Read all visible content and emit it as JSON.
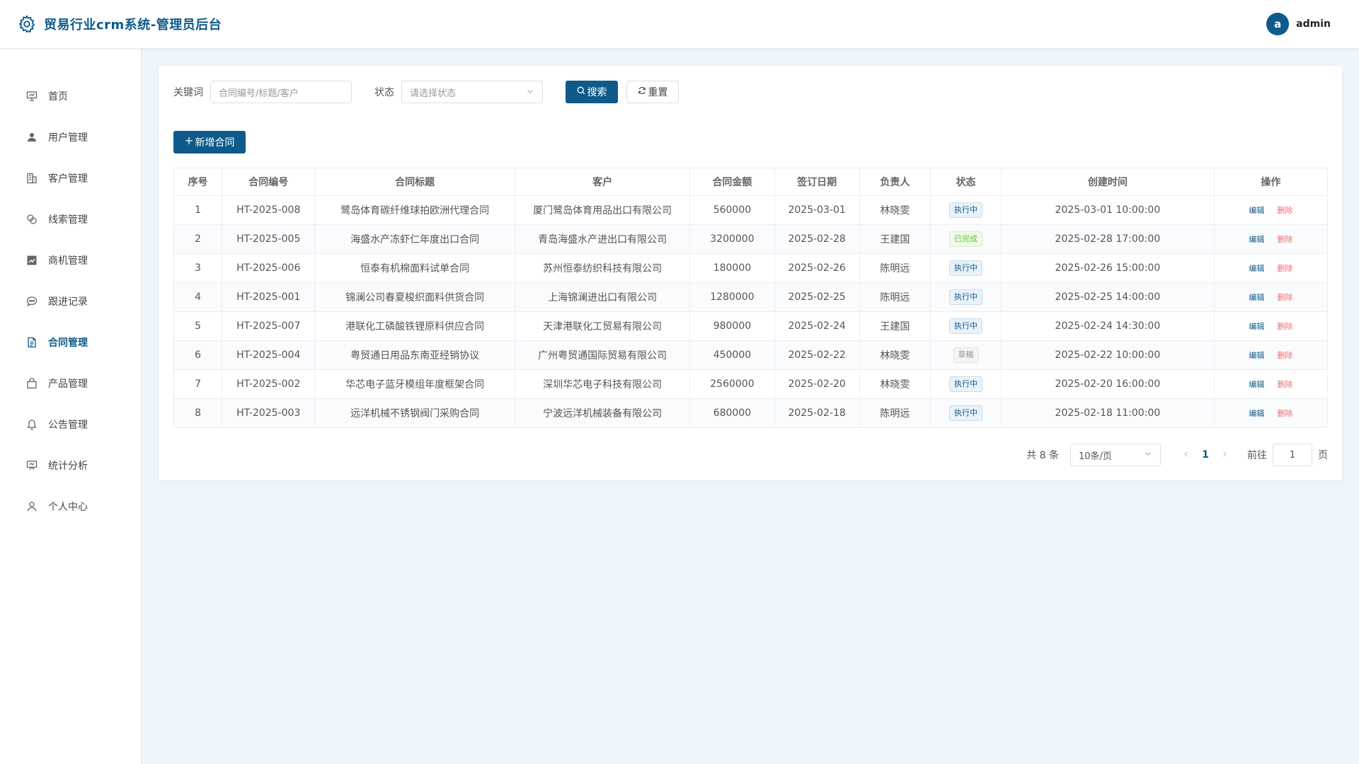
{
  "header": {
    "title": "贸易行业crm系统-管理员后台",
    "avatar_letter": "a",
    "username": "admin"
  },
  "sidebar": {
    "items": [
      {
        "label": "首页",
        "icon": "presentation-icon"
      },
      {
        "label": "用户管理",
        "icon": "user-filled-icon"
      },
      {
        "label": "客户管理",
        "icon": "building-icon"
      },
      {
        "label": "线索管理",
        "icon": "link-icon"
      },
      {
        "label": "商机管理",
        "icon": "chart-filled-icon"
      },
      {
        "label": "跟进记录",
        "icon": "chat-icon"
      },
      {
        "label": "合同管理",
        "icon": "document-icon",
        "active": true
      },
      {
        "label": "产品管理",
        "icon": "bag-icon"
      },
      {
        "label": "公告管理",
        "icon": "bell-icon"
      },
      {
        "label": "统计分析",
        "icon": "data-board-icon"
      },
      {
        "label": "个人中心",
        "icon": "user-outline-icon"
      }
    ]
  },
  "filters": {
    "keyword_label": "关键词",
    "keyword_placeholder": "合同编号/标题/客户",
    "status_label": "状态",
    "status_placeholder": "请选择状态",
    "search_label": "搜索",
    "reset_label": "重置"
  },
  "toolbar": {
    "add_label": "新增合同"
  },
  "table": {
    "columns": [
      "序号",
      "合同编号",
      "合同标题",
      "客户",
      "合同金额",
      "签订日期",
      "负责人",
      "状态",
      "创建时间",
      "操作"
    ],
    "rows": [
      {
        "no": "1",
        "code": "HT-2025-008",
        "title": "鹭岛体育碳纤维球拍欧洲代理合同",
        "customer": "厦门鹭岛体育用品出口有限公司",
        "amount": "560000",
        "date": "2025-03-01",
        "owner": "林晓雯",
        "status": "执行中",
        "created": "2025-03-01 10:00:00"
      },
      {
        "no": "2",
        "code": "HT-2025-005",
        "title": "海盛水产冻虾仁年度出口合同",
        "customer": "青岛海盛水产进出口有限公司",
        "amount": "3200000",
        "date": "2025-02-28",
        "owner": "王建国",
        "status": "已完成",
        "created": "2025-02-28 17:00:00"
      },
      {
        "no": "3",
        "code": "HT-2025-006",
        "title": "恒泰有机棉面料试单合同",
        "customer": "苏州恒泰纺织科技有限公司",
        "amount": "180000",
        "date": "2025-02-26",
        "owner": "陈明远",
        "status": "执行中",
        "created": "2025-02-26 15:00:00"
      },
      {
        "no": "4",
        "code": "HT-2025-001",
        "title": "锦澜公司春夏梭织面料供货合同",
        "customer": "上海锦澜进出口有限公司",
        "amount": "1280000",
        "date": "2025-02-25",
        "owner": "陈明远",
        "status": "执行中",
        "created": "2025-02-25 14:00:00"
      },
      {
        "no": "5",
        "code": "HT-2025-007",
        "title": "港联化工磷酸铁锂原料供应合同",
        "customer": "天津港联化工贸易有限公司",
        "amount": "980000",
        "date": "2025-02-24",
        "owner": "王建国",
        "status": "执行中",
        "created": "2025-02-24 14:30:00"
      },
      {
        "no": "6",
        "code": "HT-2025-004",
        "title": "粤贸通日用品东南亚经销协议",
        "customer": "广州粤贸通国际贸易有限公司",
        "amount": "450000",
        "date": "2025-02-22",
        "owner": "林晓雯",
        "status": "草稿",
        "created": "2025-02-22 10:00:00"
      },
      {
        "no": "7",
        "code": "HT-2025-002",
        "title": "华芯电子蓝牙模组年度框架合同",
        "customer": "深圳华芯电子科技有限公司",
        "amount": "2560000",
        "date": "2025-02-20",
        "owner": "林晓雯",
        "status": "执行中",
        "created": "2025-02-20 16:00:00"
      },
      {
        "no": "8",
        "code": "HT-2025-003",
        "title": "远洋机械不锈钢阀门采购合同",
        "customer": "宁波远洋机械装备有限公司",
        "amount": "680000",
        "date": "2025-02-18",
        "owner": "陈明远",
        "status": "执行中",
        "created": "2025-02-18 11:00:00"
      }
    ],
    "edit_label": "编辑",
    "delete_label": "删除"
  },
  "pagination": {
    "total_text": "共 8 条",
    "page_size": "10条/页",
    "current_page": "1",
    "goto_label": "前往",
    "goto_value": "1",
    "page_suffix": "页"
  },
  "colors": {
    "primary": "#0e5a8a",
    "danger": "#f56c6c",
    "success": "#67c23a",
    "background": "#eef5fc"
  }
}
